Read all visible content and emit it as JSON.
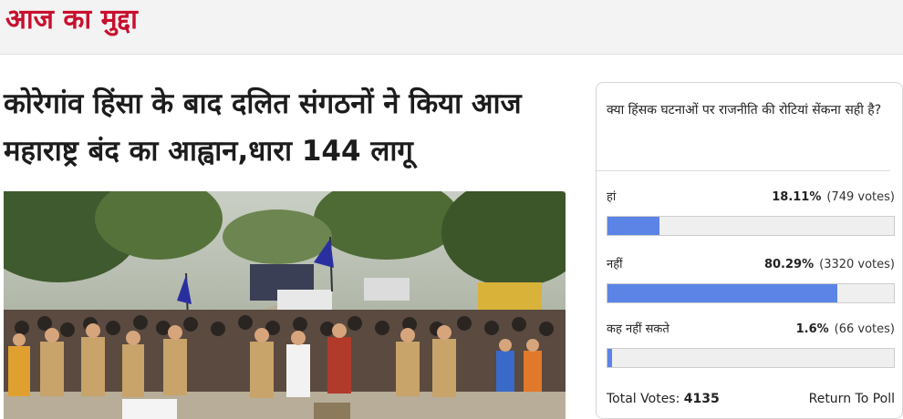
{
  "section": {
    "title": "आज का मुद्दा"
  },
  "article": {
    "headline": "कोरेगांव हिंसा के बाद दलित संगठनों ने किया आज महाराष्ट्र बंद का आह्वान,धारा 144 लागू"
  },
  "poll": {
    "question": "क्या हिंसक घटनाओं पर राजनीति की रोटियां सेंकना सही है?",
    "options": [
      {
        "label": "हां",
        "percent": "18.11%",
        "votes": "(749 votes)",
        "fill": 0.1811
      },
      {
        "label": "नहीं",
        "percent": "80.29%",
        "votes": "(3320 votes)",
        "fill": 0.8029
      },
      {
        "label": "कह नहीं सकते",
        "percent": "1.6%",
        "votes": "(66 votes)",
        "fill": 0.016
      }
    ],
    "total_label": "Total Votes:",
    "total_value": "4135",
    "return_label": "Return To Poll",
    "bar_color": "#5b84e6"
  },
  "colors": {
    "accent": "#c8102e",
    "header_bg": "#f3f3f3"
  }
}
